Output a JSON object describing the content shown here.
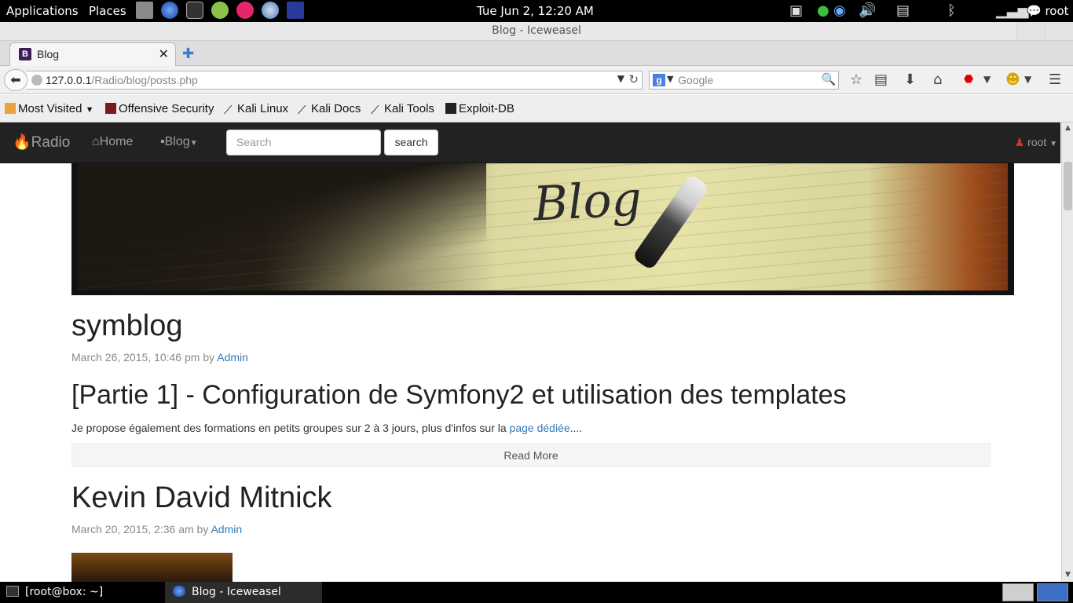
{
  "top_panel": {
    "applications": "Applications",
    "places": "Places",
    "clock": "Tue Jun  2, 12:20 AM",
    "user": "root"
  },
  "window": {
    "title": "Blog - Iceweasel"
  },
  "tabs": [
    {
      "label": "Blog",
      "favicon": "B"
    }
  ],
  "navbar": {
    "url_host": "127.0.0.1",
    "url_path": "/Radio/blog/posts.php",
    "search_engine_icon": "g",
    "search_placeholder": "Google"
  },
  "bookmarks": [
    {
      "label": "Most Visited",
      "has_dropdown": true
    },
    {
      "label": "Offensive Security"
    },
    {
      "label": "Kali Linux"
    },
    {
      "label": "Kali Docs"
    },
    {
      "label": "Kali Tools"
    },
    {
      "label": "Exploit-DB"
    }
  ],
  "site": {
    "brand": "Radio",
    "nav": {
      "home": "Home",
      "blog": "Blog"
    },
    "search_placeholder": "Search",
    "search_button": "search",
    "user": "root"
  },
  "banner": {
    "word": "Blog"
  },
  "posts": [
    {
      "title": "symblog",
      "date": "March 26, 2015, 10:46 pm",
      "by": "by",
      "author": "Admin",
      "subtitle": "[Partie 1] - Configuration de Symfony2 et utilisation des templates",
      "excerpt_start": "Je propose également des formations en petits groupes sur 2 à 3 jours, plus d'infos sur la ",
      "excerpt_link": "page dédiée",
      "excerpt_end": "....",
      "read_more": "Read More"
    },
    {
      "title": "Kevin David Mitnick",
      "date": "March 20, 2015, 2:36 am",
      "by": "by",
      "author": "Admin"
    }
  ],
  "taskbar": {
    "terminal": "[root@box: ~]",
    "browser": "Blog - Iceweasel"
  }
}
